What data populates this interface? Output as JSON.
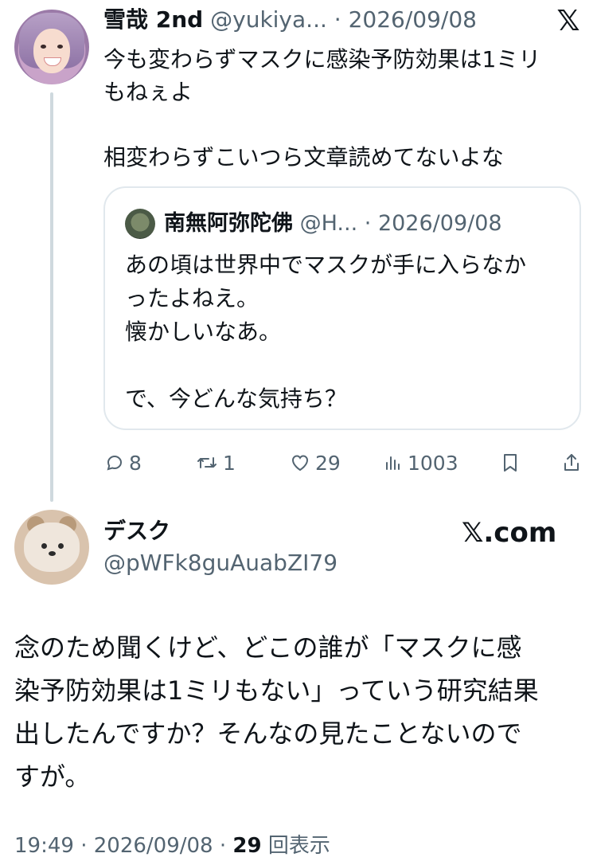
{
  "parent_tweet": {
    "author_name": "雪哉 2nd",
    "handle": "@yukiya...",
    "separator": "·",
    "date": "2026/09/08",
    "text": "今も変わらずマスクに感染予防効果は1ミリ\nもねぇよ\n\n相変わらずこいつら文章読めてないよな",
    "quoted_tweet": {
      "author_name": "南無阿弥陀佛",
      "handle": "@H...",
      "separator": "·",
      "date": "2026/09/08",
      "text": "あの頃は世界中でマスクが手に入らなか\nったよねえ。\n懐かしいなあ。\n\nで、今どんな気持ち？"
    },
    "actions": {
      "replies": "8",
      "retweets": "1",
      "likes": "29",
      "views": "1003"
    },
    "platform_icon": "x-logo-icon"
  },
  "main_tweet": {
    "author_name": "デスク",
    "handle": "@pWFk8guAuabZI79",
    "brand": "𝕏.com",
    "text": "念のため聞くけど、どこの誰が「マスクに感\n染予防効果は1ミリもない」っていう研究結果\n出したんですか？そんなの見たことないので\nすが。",
    "time": "19:49",
    "separator": "·",
    "date": "2026/09/08",
    "views_count": "29",
    "views_label": "回表示"
  }
}
